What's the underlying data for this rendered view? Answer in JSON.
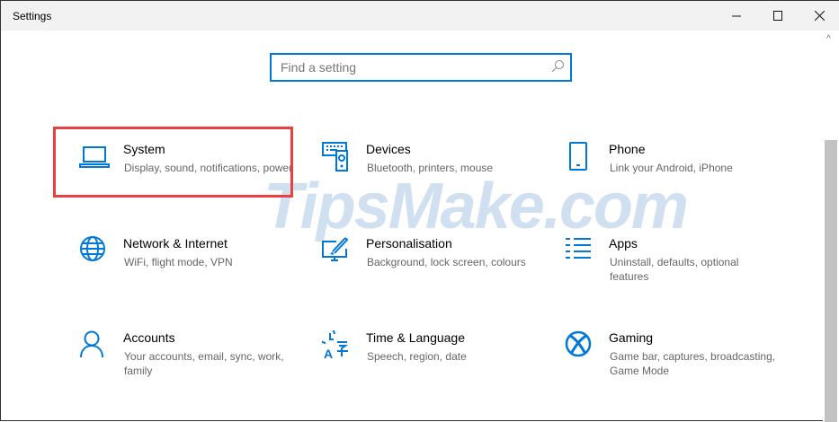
{
  "window": {
    "title": "Settings"
  },
  "search": {
    "placeholder": "Find a setting",
    "value": ""
  },
  "watermark": "TipsMake.com",
  "accent": "#0078d7",
  "tiles": [
    {
      "name": "System",
      "desc": "Display, sound, notifications, power",
      "icon": "laptop-icon",
      "highlighted": true
    },
    {
      "name": "Devices",
      "desc": "Bluetooth, printers, mouse",
      "icon": "devices-icon"
    },
    {
      "name": "Phone",
      "desc": "Link your Android, iPhone",
      "icon": "phone-icon"
    },
    {
      "name": "Network & Internet",
      "desc": "WiFi, flight mode, VPN",
      "icon": "globe-icon"
    },
    {
      "name": "Personalisation",
      "desc": "Background, lock screen, colours",
      "icon": "paintbrush-icon"
    },
    {
      "name": "Apps",
      "desc": "Uninstall, defaults, optional features",
      "icon": "apps-list-icon"
    },
    {
      "name": "Accounts",
      "desc": "Your accounts, email, sync, work, family",
      "icon": "person-icon"
    },
    {
      "name": "Time & Language",
      "desc": "Speech, region, date",
      "icon": "time-language-icon"
    },
    {
      "name": "Gaming",
      "desc": "Game bar, captures, broadcasting, Game Mode",
      "icon": "xbox-icon"
    }
  ]
}
